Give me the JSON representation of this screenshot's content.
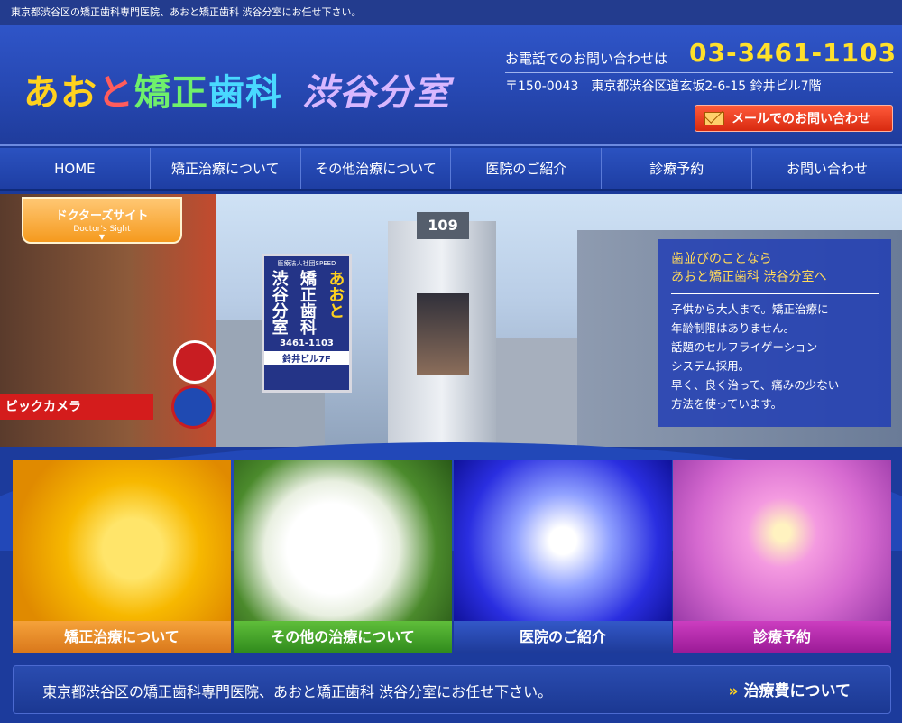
{
  "topbar": {
    "text": "東京都渋谷区の矯正歯科専門医院、あおと矯正歯科 渋谷分室にお任せ下さい。"
  },
  "header": {
    "logo": {
      "part1": "あお",
      "part2": "と",
      "part3": "矯正",
      "part4": "歯科",
      "branch": "渋谷分室"
    },
    "tel_label": "お電話でのお問い合わせは",
    "tel_number": "03-3461-1103",
    "address": "〒150-0043　東京都渋谷区道玄坂2-6-15 鈴井ビル7階",
    "mail_button": "メールでのお問い合わせ"
  },
  "nav": {
    "items": [
      "HOME",
      "矯正治療について",
      "その他治療について",
      "医院のご紹介",
      "診療予約",
      "お問い合わせ"
    ]
  },
  "hero": {
    "doctor_tab": {
      "ja": "ドクターズサイト",
      "en": "Doctor's Sight",
      "arrow": "▼"
    },
    "tower_sign": "109",
    "shop_sign": "ビックカメラ",
    "clinic_sign": {
      "corp": "医療法人社団SPEED",
      "col1": "渋谷分室",
      "col2": "矯正歯科",
      "col3": "あおと",
      "phone": "3461-1103",
      "floor": "鈴井ビル7F"
    },
    "info": {
      "title_line1": "歯並びのことなら",
      "title_line2": "あおと矯正歯科 渋谷分室へ",
      "lines": [
        "子供から大人まで。矯正治療に",
        "年齢制限はありません。",
        "話題のセルフライゲーション",
        "システム採用。",
        "早く、良く治って、痛みの少ない",
        "方法を使っています。"
      ]
    }
  },
  "tiles": [
    {
      "caption": "矯正治療について"
    },
    {
      "caption": "その他の治療について"
    },
    {
      "caption": "医院のご紹介"
    },
    {
      "caption": "診療予約"
    }
  ],
  "bottom": {
    "text": "東京都渋谷区の矯正歯科専門医院、あおと矯正歯科 渋谷分室にお任せ下さい。",
    "fee_arrow": "»",
    "fee_link": "治療費について"
  },
  "colors": {
    "accent_yellow": "#ffe02a",
    "brand_blue": "#1f3c9c",
    "mail_red": "#d82a10"
  }
}
